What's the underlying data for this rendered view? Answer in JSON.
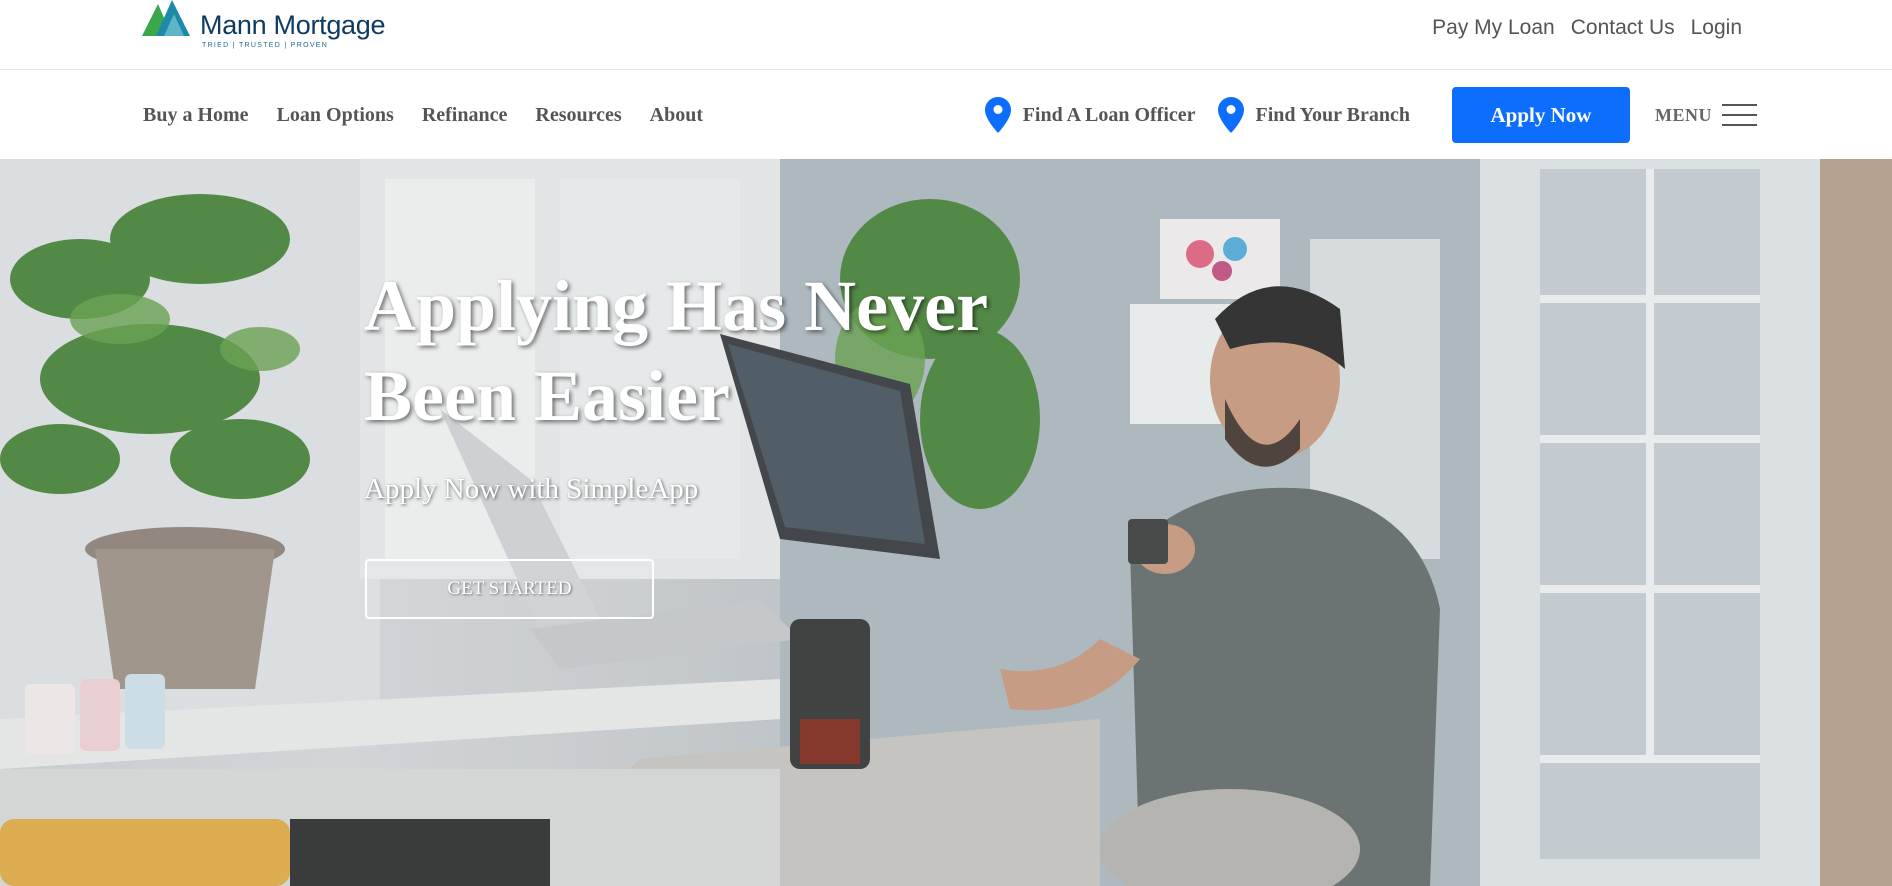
{
  "brand": {
    "name": "Mann Mortgage",
    "tagline": "TRIED | TRUSTED | PROVEN",
    "colors": {
      "green": "#3aa84a",
      "teal": "#1d8aa8",
      "navy": "#0e3b63"
    }
  },
  "utility_nav": {
    "items": [
      {
        "label": "Pay My Loan"
      },
      {
        "label": "Contact Us"
      },
      {
        "label": "Login"
      }
    ]
  },
  "main_nav": {
    "items": [
      {
        "label": "Buy a Home"
      },
      {
        "label": "Loan Options"
      },
      {
        "label": "Refinance"
      },
      {
        "label": "Resources"
      },
      {
        "label": "About"
      }
    ],
    "find_officer": {
      "label": "Find A Loan Officer",
      "icon": "map-pin-icon"
    },
    "find_branch": {
      "label": "Find Your Branch",
      "icon": "map-pin-icon"
    },
    "apply_button": {
      "label": "Apply Now",
      "color": "#0d6efd"
    },
    "menu": {
      "label": "MENU",
      "icon": "hamburger-icon"
    }
  },
  "hero": {
    "headline": "Applying Has Never Been Easier",
    "subheadline": "Apply Now with SimpleApp",
    "cta_label": "GET STARTED"
  }
}
